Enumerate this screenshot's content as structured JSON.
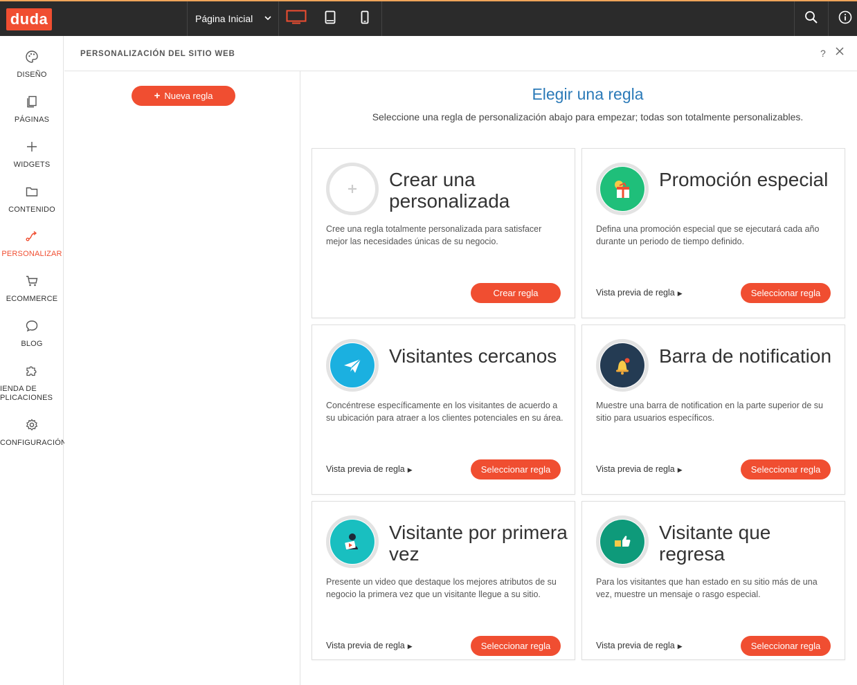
{
  "topbar": {
    "logo": "duda",
    "page_selector": "Página Inicial",
    "accent": "#f04e31"
  },
  "sidebar": {
    "items": [
      {
        "label": "DISEÑO",
        "icon": "palette-icon"
      },
      {
        "label": "PÁGINAS",
        "icon": "pages-icon"
      },
      {
        "label": "WIDGETS",
        "icon": "plus-icon"
      },
      {
        "label": "CONTENIDO",
        "icon": "folder-icon"
      },
      {
        "label": "PERSONALIZAR",
        "icon": "personalize-icon"
      },
      {
        "label": "ECOMMERCE",
        "icon": "cart-icon"
      },
      {
        "label": "BLOG",
        "icon": "chat-bubble-icon"
      },
      {
        "label": "IENDA DE",
        "label2": "PLICACIONES",
        "icon": "puzzle-icon"
      },
      {
        "label": "CONFIGURACIÓN",
        "icon": "gear-icon"
      }
    ]
  },
  "panel": {
    "title": "PERSONALIZACIÓN DEL SITIO WEB",
    "help": "?"
  },
  "left": {
    "new_rule": "Nueva regla"
  },
  "main": {
    "title": "Elegir una regla",
    "subtitle": "Seleccione una regla de personalización abajo para empezar; todas son totalmente personalizables."
  },
  "cards": [
    {
      "title": "Crear una personalizada",
      "desc": "Cree una regla totalmente personalizada para satisfacer mejor las necesidades únicas de su negocio.",
      "preview": "",
      "cta": "Crear regla",
      "color": "#ffffff"
    },
    {
      "title": "Promoción especial",
      "desc": "Defina una promoción especial que se ejecutará cada año durante un periodo de tiempo definido.",
      "preview": "Vista previa de regla",
      "cta": "Seleccionar regla",
      "color": "#1fbf7a"
    },
    {
      "title": "Visitantes cercanos",
      "desc": "Concéntrese específicamente en los visitantes de acuerdo a su ubicación para atraer a los clientes potenciales en su área.",
      "preview": "Vista previa de regla",
      "cta": "Seleccionar regla",
      "color": "#1bb0e0"
    },
    {
      "title": "Barra de notification",
      "desc": "Muestre una barra de notification en la parte superior de su sitio para usuarios específicos.",
      "preview": "Vista previa de regla",
      "cta": "Seleccionar regla",
      "color": "#243b53"
    },
    {
      "title": "Visitante por primera vez",
      "desc": "Presente un video que destaque los mejores atributos de su negocio la primera vez que un visitante llegue a su sitio.",
      "preview": "Vista previa de regla",
      "cta": "Seleccionar regla",
      "color": "#19bfc0"
    },
    {
      "title": "Visitante que regresa",
      "desc": "Para los visitantes que han estado en su sitio más de una vez, muestre un mensaje o rasgo especial.",
      "preview": "Vista previa de regla",
      "cta": "Seleccionar regla",
      "color": "#0e9a7a"
    }
  ]
}
